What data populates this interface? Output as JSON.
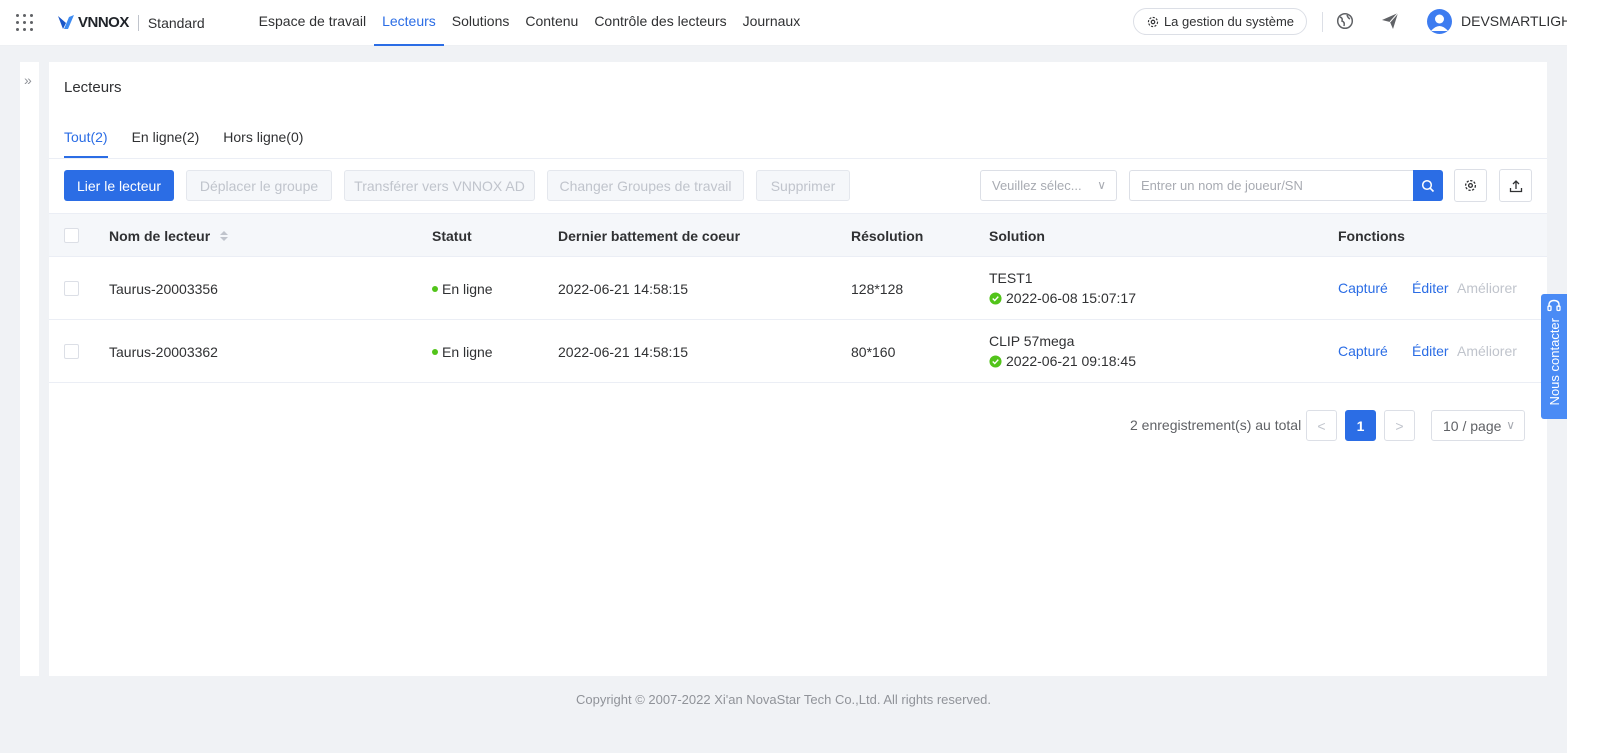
{
  "app": {
    "brand": "VNNOX",
    "edition": "Standard"
  },
  "nav": {
    "items": [
      "Espace de travail",
      "Lecteurs",
      "Solutions",
      "Contenu",
      "Contrôle des lecteurs",
      "Journaux"
    ],
    "active_index": 1
  },
  "header": {
    "system_button": "La gestion du système",
    "user_name": "DEVSMARTLIGHT"
  },
  "page": {
    "title": "Lecteurs",
    "tabs": [
      "Tout(2)",
      "En ligne(2)",
      "Hors ligne(0)"
    ],
    "active_tab": 0
  },
  "toolbar": {
    "bind_button": "Lier le lecteur",
    "move_group_button": "Déplacer le groupe",
    "transfer_button": "Transférer vers VNNOX AD",
    "change_workgroup_button": "Changer Groupes de travail",
    "delete_button": "Supprimer",
    "select_placeholder": "Veuillez sélec...",
    "search_placeholder": "Entrer un nom de joueur/SN"
  },
  "table": {
    "columns": {
      "name": "Nom de lecteur",
      "status": "Statut",
      "heartbeat": "Dernier battement de coeur",
      "resolution": "Résolution",
      "solution": "Solution",
      "functions": "Fonctions"
    },
    "rows": [
      {
        "name": "Taurus-20003356",
        "status": "En ligne",
        "heartbeat": "2022-06-21 14:58:15",
        "resolution": "128*128",
        "solution_name": "TEST1",
        "solution_time": "2022-06-08 15:07:17"
      },
      {
        "name": "Taurus-20003362",
        "status": "En ligne",
        "heartbeat": "2022-06-21 14:58:15",
        "resolution": "80*160",
        "solution_name": "CLIP 57mega",
        "solution_time": "2022-06-21 09:18:45"
      }
    ],
    "actions": {
      "capture": "Capturé",
      "edit": "Éditer",
      "improve": "Améliorer"
    }
  },
  "pagination": {
    "total_text": "2 enregistrement(s) au total",
    "prev": "<",
    "current_page": "1",
    "next": ">",
    "page_size": "10 / page"
  },
  "contact": {
    "label": "Nous contacter"
  },
  "footer": {
    "copyright": "Copyright © 2007-2022 Xi'an NovaStar Tech Co.,Ltd. All rights reserved."
  },
  "colors": {
    "accent": "#2b6de5",
    "online": "#52c41a",
    "contact": "#4a8bf5"
  }
}
